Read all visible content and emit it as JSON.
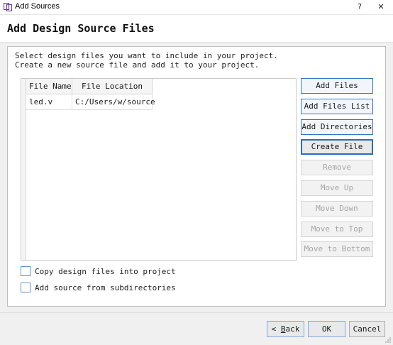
{
  "window": {
    "title": "Add Sources",
    "help_symbol": "?",
    "close_symbol": "✕",
    "app_icon": "vivado-icon"
  },
  "header": {
    "title": "Add Design Source Files"
  },
  "intro": {
    "line1": "Select design files you want to include in your project.",
    "line2": "Create a new source file and add it to your project."
  },
  "table": {
    "columns": [
      "File Name",
      "File Location"
    ],
    "rows": [
      {
        "name": "led.v",
        "location": "C:/Users/w/source"
      }
    ]
  },
  "actions": [
    {
      "label": "Add Files",
      "state": "active"
    },
    {
      "label": "Add Files List",
      "state": "active"
    },
    {
      "label": "Add Directories",
      "state": "active"
    },
    {
      "label": "Create File",
      "state": "focused"
    },
    {
      "label": "Remove",
      "state": "disabled"
    },
    {
      "label": "Move Up",
      "state": "disabled"
    },
    {
      "label": "Move Down",
      "state": "disabled"
    },
    {
      "label": "Move to Top",
      "state": "disabled"
    },
    {
      "label": "Move to Bottom",
      "state": "disabled"
    }
  ],
  "options": {
    "copy_files": {
      "label": "Copy design files into project",
      "checked": false
    },
    "subdirs": {
      "label": "Add source from subdirectories",
      "checked": false
    }
  },
  "footer": {
    "back_prefix": "< ",
    "back_mnemonic": "B",
    "back_rest": "ack",
    "ok": "OK",
    "cancel": "Cancel"
  },
  "colors": {
    "accent": "#2b78c4",
    "checkbox_border": "#5b8fd0",
    "disabled_text": "#a6a6a6"
  }
}
